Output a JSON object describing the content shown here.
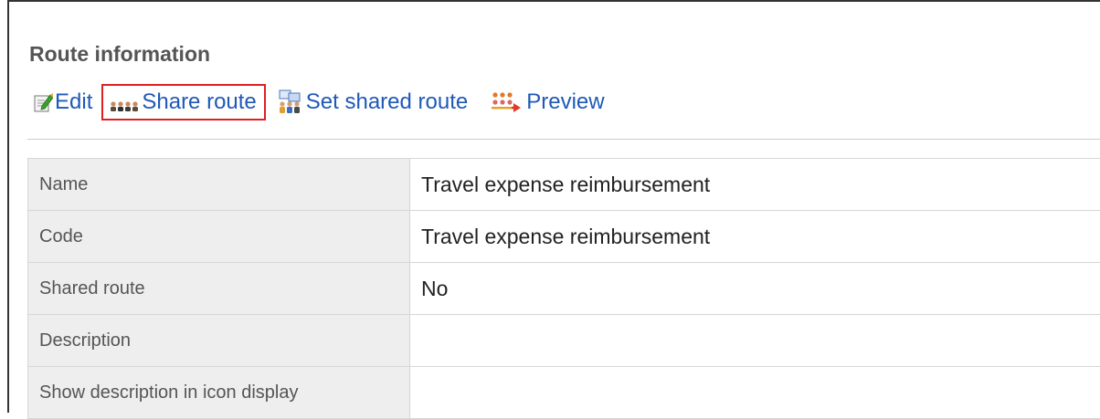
{
  "section": {
    "title": "Route information"
  },
  "toolbar": {
    "edit_label": "Edit",
    "edit_icon": "edit-icon",
    "share_label": "Share route",
    "share_icon": "share-route-icon",
    "set_shared_label": "Set shared route",
    "set_shared_icon": "set-shared-route-icon",
    "preview_label": "Preview",
    "preview_icon": "preview-icon",
    "highlight_color": "#e02020",
    "link_color": "#1f59b8"
  },
  "details": {
    "rows": [
      {
        "label": "Name",
        "value": "Travel expense reimbursement"
      },
      {
        "label": "Code",
        "value": "Travel expense reimbursement"
      },
      {
        "label": "Shared route",
        "value": "No"
      },
      {
        "label": "Description",
        "value": ""
      },
      {
        "label": "Show description in icon display",
        "value": ""
      }
    ]
  }
}
